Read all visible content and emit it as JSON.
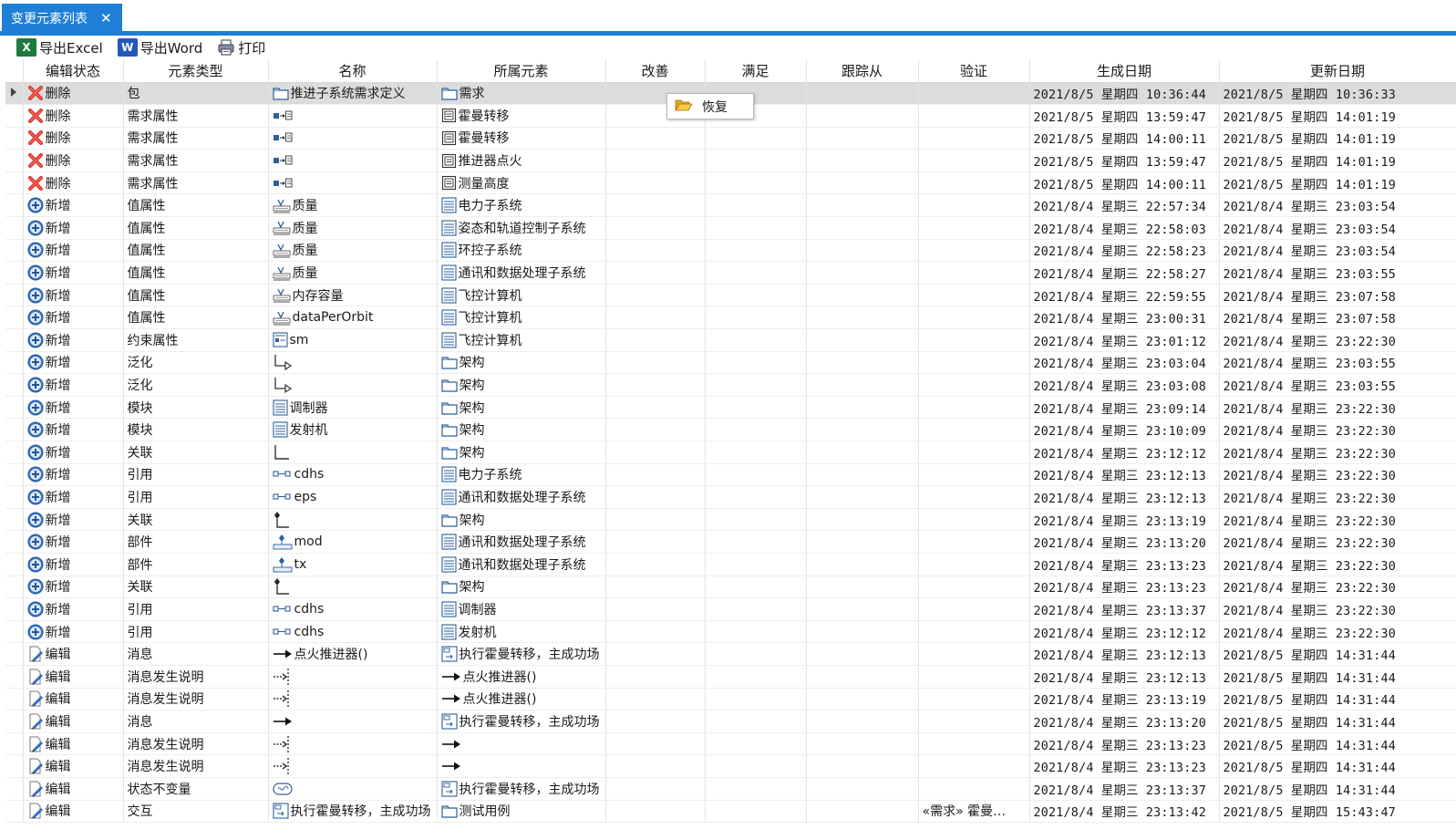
{
  "tab": {
    "title": "变更元素列表",
    "close": "✕"
  },
  "toolbar": {
    "excel_label": "导出Excel",
    "word_label": "导出Word",
    "print_label": "打印"
  },
  "columns": [
    "编辑状态",
    "元素类型",
    "名称",
    "所属元素",
    "改善",
    "满足",
    "跟踪从",
    "验证",
    "生成日期",
    "更新日期"
  ],
  "popup": {
    "label": "恢复"
  },
  "rows": [
    {
      "status": "删除",
      "status_icon": "delete-icon",
      "type": "包",
      "name": "推进子系统需求定义",
      "name_icon": "package-icon",
      "owner": "需求",
      "owner_icon": "package-icon",
      "improve": "",
      "satisfy": "",
      "trace": "",
      "verify": "",
      "created": "2021/8/5 星期四 10:36:44",
      "updated": "2021/8/5 星期四 10:36:33"
    },
    {
      "status": "删除",
      "status_icon": "delete-icon",
      "type": "需求属性",
      "name": "",
      "name_icon": "requirement-property-icon",
      "owner": "霍曼转移",
      "owner_icon": "requirement-icon",
      "improve": "",
      "satisfy": "",
      "trace": "",
      "verify": "",
      "created": "2021/8/5 星期四 13:59:47",
      "updated": "2021/8/5 星期四 14:01:19"
    },
    {
      "status": "删除",
      "status_icon": "delete-icon",
      "type": "需求属性",
      "name": "",
      "name_icon": "requirement-property-icon",
      "owner": "霍曼转移",
      "owner_icon": "requirement-icon",
      "improve": "",
      "satisfy": "",
      "trace": "",
      "verify": "",
      "created": "2021/8/5 星期四 14:00:11",
      "updated": "2021/8/5 星期四 14:01:19"
    },
    {
      "status": "删除",
      "status_icon": "delete-icon",
      "type": "需求属性",
      "name": "",
      "name_icon": "requirement-property-icon",
      "owner": "推进器点火",
      "owner_icon": "requirement-icon",
      "improve": "",
      "satisfy": "",
      "trace": "",
      "verify": "",
      "created": "2021/8/5 星期四 13:59:47",
      "updated": "2021/8/5 星期四 14:01:19"
    },
    {
      "status": "删除",
      "status_icon": "delete-icon",
      "type": "需求属性",
      "name": "",
      "name_icon": "requirement-property-icon",
      "owner": "测量高度",
      "owner_icon": "requirement-icon",
      "improve": "",
      "satisfy": "",
      "trace": "",
      "verify": "",
      "created": "2021/8/5 星期四 14:00:11",
      "updated": "2021/8/5 星期四 14:01:19"
    },
    {
      "status": "新增",
      "status_icon": "add-icon",
      "type": "值属性",
      "name": "质量",
      "name_icon": "value-property-icon",
      "owner": "电力子系统",
      "owner_icon": "block-icon",
      "improve": "",
      "satisfy": "",
      "trace": "",
      "verify": "",
      "created": "2021/8/4 星期三 22:57:34",
      "updated": "2021/8/4 星期三 23:03:54"
    },
    {
      "status": "新增",
      "status_icon": "add-icon",
      "type": "值属性",
      "name": "质量",
      "name_icon": "value-property-icon",
      "owner": "姿态和轨道控制子系统",
      "owner_icon": "block-icon",
      "improve": "",
      "satisfy": "",
      "trace": "",
      "verify": "",
      "created": "2021/8/4 星期三 22:58:03",
      "updated": "2021/8/4 星期三 23:03:54"
    },
    {
      "status": "新增",
      "status_icon": "add-icon",
      "type": "值属性",
      "name": "质量",
      "name_icon": "value-property-icon",
      "owner": "环控子系统",
      "owner_icon": "block-icon",
      "improve": "",
      "satisfy": "",
      "trace": "",
      "verify": "",
      "created": "2021/8/4 星期三 22:58:23",
      "updated": "2021/8/4 星期三 23:03:54"
    },
    {
      "status": "新增",
      "status_icon": "add-icon",
      "type": "值属性",
      "name": "质量",
      "name_icon": "value-property-icon",
      "owner": "通讯和数据处理子系统",
      "owner_icon": "block-icon",
      "improve": "",
      "satisfy": "",
      "trace": "",
      "verify": "",
      "created": "2021/8/4 星期三 22:58:27",
      "updated": "2021/8/4 星期三 23:03:55"
    },
    {
      "status": "新增",
      "status_icon": "add-icon",
      "type": "值属性",
      "name": "内存容量",
      "name_icon": "value-property-icon",
      "owner": "飞控计算机",
      "owner_icon": "block-icon",
      "improve": "",
      "satisfy": "",
      "trace": "",
      "verify": "",
      "created": "2021/8/4 星期三 22:59:55",
      "updated": "2021/8/4 星期三 23:07:58"
    },
    {
      "status": "新增",
      "status_icon": "add-icon",
      "type": "值属性",
      "name": "dataPerOrbit",
      "name_icon": "value-property-icon",
      "owner": "飞控计算机",
      "owner_icon": "block-icon",
      "improve": "",
      "satisfy": "",
      "trace": "",
      "verify": "",
      "created": "2021/8/4 星期三 23:00:31",
      "updated": "2021/8/4 星期三 23:07:58"
    },
    {
      "status": "新增",
      "status_icon": "add-icon",
      "type": "约束属性",
      "name": "sm",
      "name_icon": "constraint-property-icon",
      "owner": "飞控计算机",
      "owner_icon": "block-icon",
      "improve": "",
      "satisfy": "",
      "trace": "",
      "verify": "",
      "created": "2021/8/4 星期三 23:01:12",
      "updated": "2021/8/4 星期三 23:22:30"
    },
    {
      "status": "新增",
      "status_icon": "add-icon",
      "type": "泛化",
      "name": "",
      "name_icon": "generalization-icon",
      "owner": "架构",
      "owner_icon": "package-icon",
      "improve": "",
      "satisfy": "",
      "trace": "",
      "verify": "",
      "created": "2021/8/4 星期三 23:03:04",
      "updated": "2021/8/4 星期三 23:03:55"
    },
    {
      "status": "新增",
      "status_icon": "add-icon",
      "type": "泛化",
      "name": "",
      "name_icon": "generalization-icon",
      "owner": "架构",
      "owner_icon": "package-icon",
      "improve": "",
      "satisfy": "",
      "trace": "",
      "verify": "",
      "created": "2021/8/4 星期三 23:03:08",
      "updated": "2021/8/4 星期三 23:03:55"
    },
    {
      "status": "新增",
      "status_icon": "add-icon",
      "type": "模块",
      "name": "调制器",
      "name_icon": "block-icon",
      "owner": "架构",
      "owner_icon": "package-icon",
      "improve": "",
      "satisfy": "",
      "trace": "",
      "verify": "",
      "created": "2021/8/4 星期三 23:09:14",
      "updated": "2021/8/4 星期三 23:22:30"
    },
    {
      "status": "新增",
      "status_icon": "add-icon",
      "type": "模块",
      "name": "发射机",
      "name_icon": "block-icon",
      "owner": "架构",
      "owner_icon": "package-icon",
      "improve": "",
      "satisfy": "",
      "trace": "",
      "verify": "",
      "created": "2021/8/4 星期三 23:10:09",
      "updated": "2021/8/4 星期三 23:22:30"
    },
    {
      "status": "新增",
      "status_icon": "add-icon",
      "type": "关联",
      "name": "",
      "name_icon": "association-icon",
      "owner": "架构",
      "owner_icon": "package-icon",
      "improve": "",
      "satisfy": "",
      "trace": "",
      "verify": "",
      "created": "2021/8/4 星期三 23:12:12",
      "updated": "2021/8/4 星期三 23:22:30"
    },
    {
      "status": "新增",
      "status_icon": "add-icon",
      "type": "引用",
      "name": "cdhs",
      "name_icon": "reference-icon",
      "owner": "电力子系统",
      "owner_icon": "block-icon",
      "improve": "",
      "satisfy": "",
      "trace": "",
      "verify": "",
      "created": "2021/8/4 星期三 23:12:13",
      "updated": "2021/8/4 星期三 23:22:30"
    },
    {
      "status": "新增",
      "status_icon": "add-icon",
      "type": "引用",
      "name": "eps",
      "name_icon": "reference-icon",
      "owner": "通讯和数据处理子系统",
      "owner_icon": "block-icon",
      "improve": "",
      "satisfy": "",
      "trace": "",
      "verify": "",
      "created": "2021/8/4 星期三 23:12:13",
      "updated": "2021/8/4 星期三 23:22:30"
    },
    {
      "status": "新增",
      "status_icon": "add-icon",
      "type": "关联",
      "name": "",
      "name_icon": "composite-association-icon",
      "owner": "架构",
      "owner_icon": "package-icon",
      "improve": "",
      "satisfy": "",
      "trace": "",
      "verify": "",
      "created": "2021/8/4 星期三 23:13:19",
      "updated": "2021/8/4 星期三 23:22:30"
    },
    {
      "status": "新增",
      "status_icon": "add-icon",
      "type": "部件",
      "name": "mod",
      "name_icon": "part-icon",
      "owner": "通讯和数据处理子系统",
      "owner_icon": "block-icon",
      "improve": "",
      "satisfy": "",
      "trace": "",
      "verify": "",
      "created": "2021/8/4 星期三 23:13:20",
      "updated": "2021/8/4 星期三 23:22:30"
    },
    {
      "status": "新增",
      "status_icon": "add-icon",
      "type": "部件",
      "name": "tx",
      "name_icon": "part-icon",
      "owner": "通讯和数据处理子系统",
      "owner_icon": "block-icon",
      "improve": "",
      "satisfy": "",
      "trace": "",
      "verify": "",
      "created": "2021/8/4 星期三 23:13:23",
      "updated": "2021/8/4 星期三 23:22:30"
    },
    {
      "status": "新增",
      "status_icon": "add-icon",
      "type": "关联",
      "name": "",
      "name_icon": "composite-association-icon",
      "owner": "架构",
      "owner_icon": "package-icon",
      "improve": "",
      "satisfy": "",
      "trace": "",
      "verify": "",
      "created": "2021/8/4 星期三 23:13:23",
      "updated": "2021/8/4 星期三 23:22:30"
    },
    {
      "status": "新增",
      "status_icon": "add-icon",
      "type": "引用",
      "name": "cdhs",
      "name_icon": "reference-icon",
      "owner": "调制器",
      "owner_icon": "block-icon",
      "improve": "",
      "satisfy": "",
      "trace": "",
      "verify": "",
      "created": "2021/8/4 星期三 23:13:37",
      "updated": "2021/8/4 星期三 23:22:30"
    },
    {
      "status": "新增",
      "status_icon": "add-icon",
      "type": "引用",
      "name": "cdhs",
      "name_icon": "reference-icon",
      "owner": "发射机",
      "owner_icon": "block-icon",
      "improve": "",
      "satisfy": "",
      "trace": "",
      "verify": "",
      "created": "2021/8/4 星期三 23:12:12",
      "updated": "2021/8/4 星期三 23:22:30"
    },
    {
      "status": "编辑",
      "status_icon": "edit-icon",
      "type": "消息",
      "name": "点火推进器()",
      "name_icon": "message-icon",
      "owner": "执行霍曼转移，主成功场",
      "owner_icon": "interaction-icon",
      "improve": "",
      "satisfy": "",
      "trace": "",
      "verify": "",
      "created": "2021/8/4 星期三 23:12:13",
      "updated": "2021/8/5 星期四 14:31:44"
    },
    {
      "status": "编辑",
      "status_icon": "edit-icon",
      "type": "消息发生说明",
      "name": "",
      "name_icon": "message-occurrence-icon",
      "owner": "点火推进器()",
      "owner_icon": "message-icon",
      "improve": "",
      "satisfy": "",
      "trace": "",
      "verify": "",
      "created": "2021/8/4 星期三 23:12:13",
      "updated": "2021/8/5 星期四 14:31:44"
    },
    {
      "status": "编辑",
      "status_icon": "edit-icon",
      "type": "消息发生说明",
      "name": "",
      "name_icon": "message-occurrence-icon",
      "owner": "点火推进器()",
      "owner_icon": "message-icon",
      "improve": "",
      "satisfy": "",
      "trace": "",
      "verify": "",
      "created": "2021/8/4 星期三 23:13:19",
      "updated": "2021/8/5 星期四 14:31:44"
    },
    {
      "status": "编辑",
      "status_icon": "edit-icon",
      "type": "消息",
      "name": "",
      "name_icon": "message-icon",
      "owner": "执行霍曼转移，主成功场",
      "owner_icon": "interaction-icon",
      "improve": "",
      "satisfy": "",
      "trace": "",
      "verify": "",
      "created": "2021/8/4 星期三 23:13:20",
      "updated": "2021/8/5 星期四 14:31:44"
    },
    {
      "status": "编辑",
      "status_icon": "edit-icon",
      "type": "消息发生说明",
      "name": "",
      "name_icon": "message-occurrence-icon",
      "owner": "",
      "owner_icon": "message-icon",
      "improve": "",
      "satisfy": "",
      "trace": "",
      "verify": "",
      "created": "2021/8/4 星期三 23:13:23",
      "updated": "2021/8/5 星期四 14:31:44"
    },
    {
      "status": "编辑",
      "status_icon": "edit-icon",
      "type": "消息发生说明",
      "name": "",
      "name_icon": "message-occurrence-icon",
      "owner": "",
      "owner_icon": "message-icon",
      "improve": "",
      "satisfy": "",
      "trace": "",
      "verify": "",
      "created": "2021/8/4 星期三 23:13:23",
      "updated": "2021/8/5 星期四 14:31:44"
    },
    {
      "status": "编辑",
      "status_icon": "edit-icon",
      "type": "状态不变量",
      "name": "",
      "name_icon": "state-invariant-icon",
      "owner": "执行霍曼转移，主成功场",
      "owner_icon": "interaction-icon",
      "improve": "",
      "satisfy": "",
      "trace": "",
      "verify": "",
      "created": "2021/8/4 星期三 23:13:37",
      "updated": "2021/8/5 星期四 14:31:44"
    },
    {
      "status": "编辑",
      "status_icon": "edit-icon",
      "type": "交互",
      "name": "执行霍曼转移，主成功场",
      "name_icon": "interaction-icon",
      "owner": "测试用例",
      "owner_icon": "package-icon",
      "improve": "",
      "satisfy": "",
      "trace": "",
      "verify": "«需求» 霍曼…",
      "created": "2021/8/4 星期三 23:13:42",
      "updated": "2021/8/5 星期四 15:43:47"
    }
  ],
  "colors": {
    "accent": "#1f7fd6",
    "delete": "#d9312b",
    "add": "#3a78c9",
    "selected_row": "#dcdcdc"
  }
}
